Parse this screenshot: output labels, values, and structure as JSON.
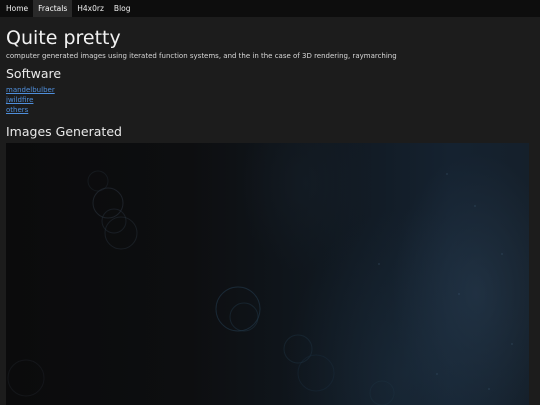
{
  "nav": {
    "items": [
      {
        "label": "Home"
      },
      {
        "label": "Fractals"
      },
      {
        "label": "H4x0rz"
      },
      {
        "label": "Blog"
      }
    ]
  },
  "header": {
    "title": "Quite pretty",
    "subtitle": "computer generated images using iterated function systems, and the in the case of 3D rendering, raymarching"
  },
  "software": {
    "heading": "Software",
    "links": [
      {
        "label": "mandelbulber"
      },
      {
        "label": "jwildfire"
      },
      {
        "label": "others"
      }
    ]
  },
  "images": {
    "heading": "Images Generated"
  },
  "colors": {
    "background": "#1c1c1c",
    "navbar": "#0d0d0d",
    "nav_active": "#2a2a2a",
    "link": "#4f8fdc"
  }
}
